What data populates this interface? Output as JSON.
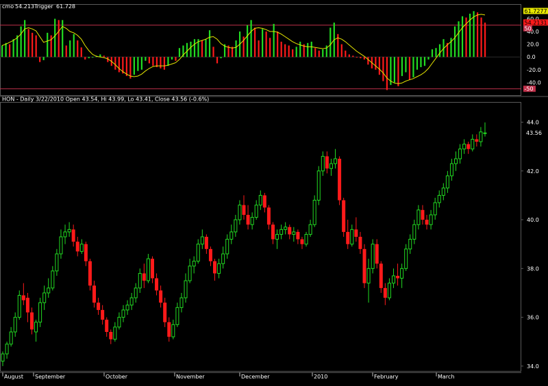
{
  "osc_header": {
    "name": "cmo",
    "value": "54.213",
    "trigger_label": "Trigger",
    "trigger_value": "61.728"
  },
  "price_header": "HON - Daily 3/22/2010 Open 43.54, Hi 43.99, Lo 43.41, Close 43.56 (-0.6%)",
  "colors": {
    "up": "#22dd22",
    "down": "#ff1a1a",
    "trigger": "#e6e600",
    "level": "#c0304a",
    "frame": "#5a5a5a"
  },
  "chart_data": [
    {
      "type": "bar",
      "title": "cmo",
      "ylim": [
        -60,
        82
      ],
      "yticks": [
        "60.0",
        "40.0",
        "20.0",
        "0.0",
        "-20.0",
        "-40.0"
      ],
      "levels": [
        "50",
        "-50"
      ],
      "last_value_tags": [
        "61.7277",
        "54.2131"
      ],
      "series": [
        {
          "name": "cmo",
          "values": [
            18,
            22,
            20,
            28,
            34,
            48,
            58,
            44,
            38,
            34,
            -8,
            -5,
            38,
            34,
            60,
            58,
            58,
            18,
            26,
            36,
            26,
            15,
            -4,
            -2,
            0,
            2,
            4,
            2,
            -8,
            -14,
            -20,
            -24,
            -26,
            -30,
            -34,
            -28,
            -22,
            -20,
            -6,
            -10,
            -14,
            -16,
            -18,
            -20,
            -14,
            -4,
            -6,
            14,
            18,
            22,
            24,
            28,
            28,
            26,
            28,
            42,
            16,
            -10,
            -2,
            20,
            18,
            16,
            26,
            40,
            32,
            50,
            58,
            46,
            26,
            44,
            40,
            30,
            52,
            40,
            24,
            20,
            18,
            12,
            16,
            24,
            20,
            22,
            24,
            14,
            10,
            12,
            18,
            46,
            54,
            36,
            20,
            10,
            4,
            2,
            0,
            -2,
            -4,
            -12,
            -18,
            -20,
            -28,
            -38,
            -52,
            -44,
            -40,
            -46,
            -30,
            -24,
            -36,
            -32,
            -20,
            -16,
            -14,
            -4,
            12,
            14,
            20,
            28,
            22,
            30,
            48,
            56,
            64,
            62,
            68,
            72,
            70,
            62,
            54
          ]
        },
        {
          "name": "Trigger",
          "values": [
            18,
            20,
            23,
            26,
            30,
            36,
            44,
            46,
            44,
            41,
            32,
            23,
            25,
            27,
            33,
            40,
            48,
            45,
            40,
            38,
            34,
            28,
            18,
            10,
            4,
            1,
            0,
            -1,
            -3,
            -7,
            -12,
            -18,
            -23,
            -27,
            -30,
            -31,
            -30,
            -27,
            -22,
            -18,
            -15,
            -14,
            -14,
            -14,
            -13,
            -11,
            -9,
            -4,
            3,
            9,
            15,
            20,
            24,
            26,
            28,
            31,
            32,
            28,
            21,
            17,
            15,
            14,
            15,
            20,
            26,
            33,
            40,
            45,
            46,
            45,
            43,
            40,
            40,
            39,
            36,
            32,
            28,
            24,
            21,
            19,
            17,
            16,
            16,
            15,
            14,
            13,
            14,
            19,
            27,
            30,
            28,
            24,
            19,
            14,
            9,
            5,
            1,
            -4,
            -9,
            -14,
            -19,
            -25,
            -33,
            -38,
            -41,
            -42,
            -41,
            -38,
            -36,
            -34,
            -31,
            -28,
            -24,
            -18,
            -10,
            -2,
            6,
            13,
            19,
            24,
            30,
            38,
            46,
            52,
            58,
            63,
            66,
            67,
            66
          ]
        }
      ]
    },
    {
      "type": "candlestick",
      "title": "HON - Daily 3/22/2010",
      "x": [
        "August",
        "September",
        "October",
        "November",
        "December",
        "2010",
        "February",
        "March"
      ],
      "ylim": [
        33.8,
        44.8
      ],
      "yticks": [
        "44.0",
        "42.0",
        "40.0",
        "38.0",
        "36.0",
        "34.0"
      ],
      "last_price": "43.56",
      "ohlc": [
        [
          34.2,
          34.6,
          34.0,
          34.5
        ],
        [
          34.5,
          35.0,
          34.3,
          34.9
        ],
        [
          34.9,
          35.6,
          34.8,
          35.4
        ],
        [
          35.4,
          36.2,
          35.2,
          36.0
        ],
        [
          36.0,
          37.1,
          35.9,
          36.9
        ],
        [
          36.9,
          37.4,
          36.5,
          36.7
        ],
        [
          36.8,
          37.0,
          35.8,
          36.2
        ],
        [
          36.2,
          36.4,
          35.3,
          35.5
        ],
        [
          35.4,
          35.9,
          35.0,
          35.8
        ],
        [
          35.8,
          36.8,
          35.6,
          36.6
        ],
        [
          36.6,
          37.3,
          36.3,
          37.0
        ],
        [
          37.0,
          37.6,
          36.8,
          37.2
        ],
        [
          37.2,
          38.1,
          37.1,
          37.9
        ],
        [
          37.9,
          38.8,
          37.7,
          38.6
        ],
        [
          38.6,
          39.6,
          38.4,
          39.3
        ],
        [
          39.3,
          39.8,
          39.0,
          39.5
        ],
        [
          39.5,
          39.9,
          39.3,
          39.6
        ],
        [
          39.6,
          39.8,
          38.9,
          39.1
        ],
        [
          39.1,
          39.3,
          38.5,
          38.7
        ],
        [
          38.7,
          39.2,
          38.6,
          39.0
        ],
        [
          39.0,
          39.1,
          38.1,
          38.3
        ],
        [
          38.3,
          38.4,
          37.1,
          37.3
        ],
        [
          37.3,
          37.5,
          36.4,
          36.6
        ],
        [
          36.6,
          36.8,
          36.1,
          36.3
        ],
        [
          36.3,
          36.5,
          35.7,
          35.9
        ],
        [
          35.9,
          36.0,
          35.2,
          35.4
        ],
        [
          35.4,
          35.5,
          34.9,
          35.1
        ],
        [
          35.1,
          35.8,
          35.0,
          35.6
        ],
        [
          35.6,
          36.2,
          35.5,
          36.0
        ],
        [
          36.0,
          36.5,
          35.8,
          36.3
        ],
        [
          36.3,
          36.7,
          36.1,
          36.5
        ],
        [
          36.5,
          37.0,
          36.3,
          36.8
        ],
        [
          36.8,
          37.4,
          36.6,
          37.2
        ],
        [
          37.2,
          38.0,
          37.0,
          37.8
        ],
        [
          37.8,
          38.2,
          37.2,
          37.5
        ],
        [
          37.5,
          38.6,
          37.4,
          38.4
        ],
        [
          38.4,
          38.5,
          37.4,
          37.6
        ],
        [
          37.6,
          37.8,
          36.9,
          37.1
        ],
        [
          37.1,
          37.3,
          36.4,
          36.6
        ],
        [
          36.6,
          36.8,
          35.6,
          35.8
        ],
        [
          35.8,
          36.0,
          35.0,
          35.2
        ],
        [
          35.2,
          35.9,
          35.1,
          35.7
        ],
        [
          35.7,
          36.6,
          35.6,
          36.4
        ],
        [
          36.4,
          37.0,
          36.2,
          36.8
        ],
        [
          36.8,
          37.8,
          36.6,
          37.5
        ],
        [
          37.5,
          38.4,
          37.4,
          38.1
        ],
        [
          38.1,
          38.5,
          37.8,
          38.3
        ],
        [
          38.3,
          39.2,
          38.2,
          39.0
        ],
        [
          39.0,
          39.6,
          38.8,
          39.3
        ],
        [
          39.3,
          39.4,
          38.6,
          38.8
        ],
        [
          38.8,
          38.9,
          38.1,
          38.3
        ],
        [
          38.3,
          38.4,
          37.5,
          37.8
        ],
        [
          37.8,
          38.4,
          37.6,
          38.2
        ],
        [
          38.2,
          38.9,
          38.0,
          38.6
        ],
        [
          38.6,
          39.4,
          38.4,
          39.2
        ],
        [
          39.2,
          39.8,
          39.0,
          39.5
        ],
        [
          39.5,
          40.2,
          39.3,
          40.0
        ],
        [
          40.0,
          40.8,
          39.8,
          40.6
        ],
        [
          40.6,
          41.0,
          40.0,
          40.2
        ],
        [
          40.2,
          40.6,
          39.6,
          39.8
        ],
        [
          39.8,
          40.3,
          39.6,
          40.1
        ],
        [
          40.1,
          40.8,
          40.0,
          40.6
        ],
        [
          40.6,
          41.2,
          40.4,
          41.0
        ],
        [
          41.0,
          41.1,
          40.3,
          40.5
        ],
        [
          40.5,
          40.6,
          39.6,
          39.8
        ],
        [
          39.8,
          39.9,
          39.0,
          39.2
        ],
        [
          39.2,
          39.6,
          38.8,
          39.4
        ],
        [
          39.4,
          39.8,
          39.2,
          39.6
        ],
        [
          39.6,
          39.9,
          39.4,
          39.7
        ],
        [
          39.7,
          39.8,
          39.2,
          39.4
        ],
        [
          39.4,
          39.7,
          39.1,
          39.5
        ],
        [
          39.5,
          39.6,
          39.0,
          39.2
        ],
        [
          39.2,
          39.3,
          38.8,
          39.0
        ],
        [
          39.0,
          39.5,
          38.9,
          39.4
        ],
        [
          39.4,
          40.0,
          39.3,
          39.8
        ],
        [
          39.8,
          41.0,
          39.7,
          40.8
        ],
        [
          40.8,
          42.2,
          40.6,
          42.0
        ],
        [
          42.0,
          42.8,
          41.8,
          42.6
        ],
        [
          42.6,
          42.8,
          41.9,
          42.1
        ],
        [
          42.1,
          42.5,
          41.8,
          42.3
        ],
        [
          42.3,
          42.9,
          42.1,
          42.5
        ],
        [
          42.5,
          42.6,
          40.6,
          40.8
        ],
        [
          40.8,
          40.9,
          39.3,
          39.5
        ],
        [
          39.5,
          40.0,
          38.8,
          39.0
        ],
        [
          39.0,
          39.8,
          38.9,
          39.6
        ],
        [
          39.6,
          40.1,
          39.1,
          39.3
        ],
        [
          39.3,
          39.5,
          38.6,
          38.8
        ],
        [
          38.8,
          39.0,
          37.2,
          37.4
        ],
        [
          37.4,
          38.4,
          36.6,
          38.0
        ],
        [
          38.0,
          39.2,
          37.8,
          39.0
        ],
        [
          39.0,
          39.2,
          38.0,
          38.2
        ],
        [
          38.2,
          38.3,
          37.0,
          37.2
        ],
        [
          37.2,
          37.4,
          36.5,
          36.8
        ],
        [
          36.8,
          37.6,
          36.7,
          37.4
        ],
        [
          37.4,
          38.0,
          37.2,
          37.7
        ],
        [
          37.7,
          38.2,
          37.3,
          37.6
        ],
        [
          37.6,
          38.2,
          37.2,
          38.0
        ],
        [
          38.0,
          39.0,
          37.9,
          38.8
        ],
        [
          38.8,
          39.4,
          38.6,
          39.2
        ],
        [
          39.2,
          40.0,
          39.0,
          39.8
        ],
        [
          39.8,
          40.6,
          39.6,
          40.4
        ],
        [
          40.4,
          40.6,
          39.8,
          40.0
        ],
        [
          40.0,
          40.2,
          39.6,
          39.8
        ],
        [
          39.8,
          40.4,
          39.6,
          40.2
        ],
        [
          40.2,
          40.9,
          40.0,
          40.7
        ],
        [
          40.7,
          41.2,
          40.5,
          41.0
        ],
        [
          41.0,
          41.5,
          40.8,
          41.3
        ],
        [
          41.3,
          42.0,
          41.1,
          41.8
        ],
        [
          41.8,
          42.5,
          41.6,
          42.3
        ],
        [
          42.3,
          42.8,
          42.0,
          42.5
        ],
        [
          42.5,
          43.1,
          42.3,
          42.9
        ],
        [
          42.9,
          43.3,
          42.7,
          43.1
        ],
        [
          43.1,
          43.2,
          42.7,
          42.9
        ],
        [
          42.9,
          43.5,
          42.8,
          43.3
        ],
        [
          43.3,
          43.5,
          43.0,
          43.2
        ],
        [
          43.2,
          43.8,
          43.0,
          43.6
        ],
        [
          43.54,
          43.99,
          43.41,
          43.56
        ]
      ]
    }
  ]
}
